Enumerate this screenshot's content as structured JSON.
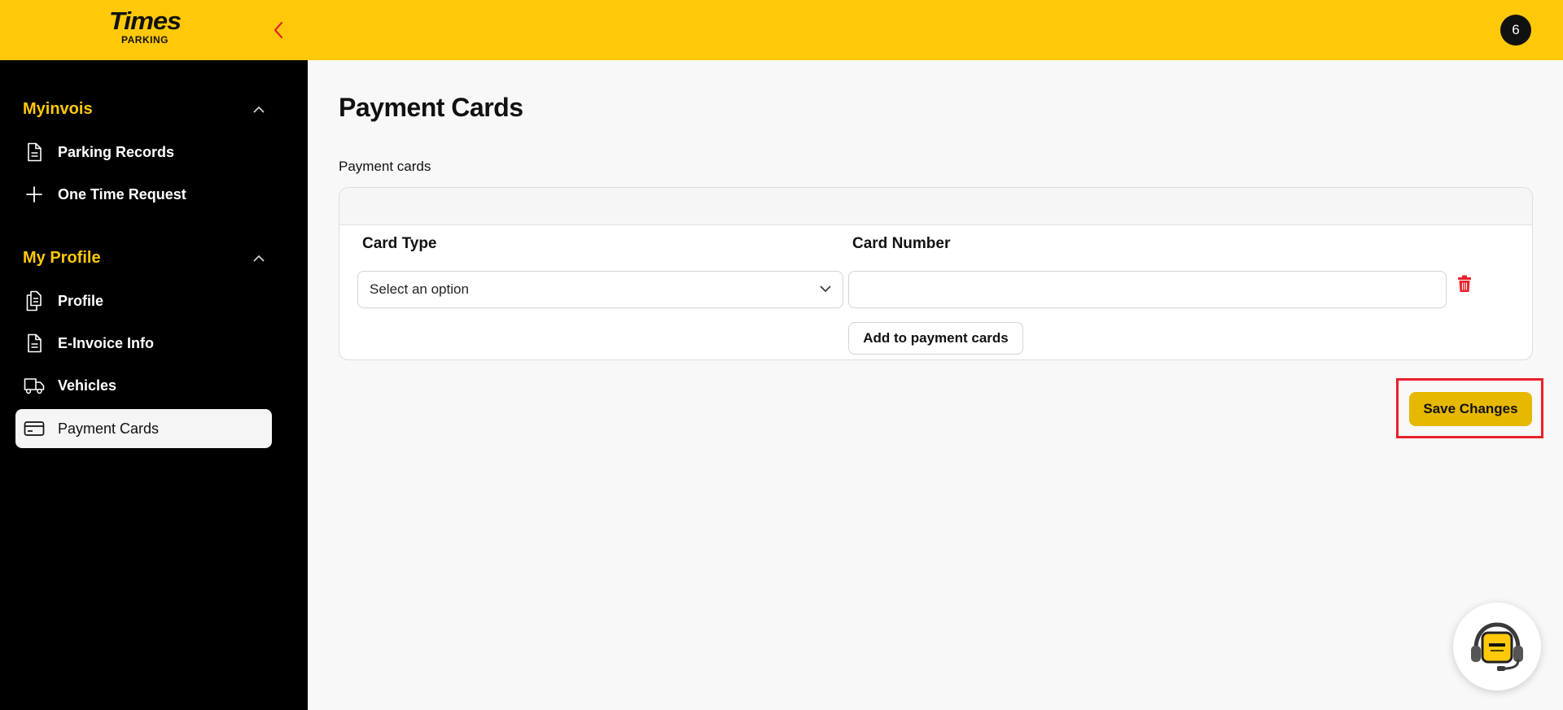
{
  "header": {
    "logo_main": "Times",
    "logo_sub": "PARKING",
    "avatar_text": "6"
  },
  "sidebar": {
    "sections": [
      {
        "title": "Myinvois",
        "items": [
          {
            "label": "Parking Records",
            "icon": "document-icon"
          },
          {
            "label": "One Time Request",
            "icon": "plus-icon"
          }
        ]
      },
      {
        "title": "My Profile",
        "items": [
          {
            "label": "Profile",
            "icon": "documents-icon"
          },
          {
            "label": "E-Invoice Info",
            "icon": "document-icon"
          },
          {
            "label": "Vehicles",
            "icon": "truck-icon"
          },
          {
            "label": "Payment Cards",
            "icon": "credit-card-icon",
            "active": true
          }
        ]
      }
    ]
  },
  "main": {
    "title": "Payment Cards",
    "section_label": "Payment cards",
    "columns": {
      "card_type": "Card Type",
      "card_number": "Card Number"
    },
    "card_type_select": {
      "value": "Select an option"
    },
    "card_number_input": {
      "value": "",
      "placeholder": ""
    },
    "add_button": "Add to payment cards",
    "save_button": "Save Changes"
  },
  "colors": {
    "brand_yellow": "#ffc90a",
    "save_yellow": "#e6b800",
    "danger_red": "#e8212b",
    "sidebar_bg": "#000000"
  }
}
